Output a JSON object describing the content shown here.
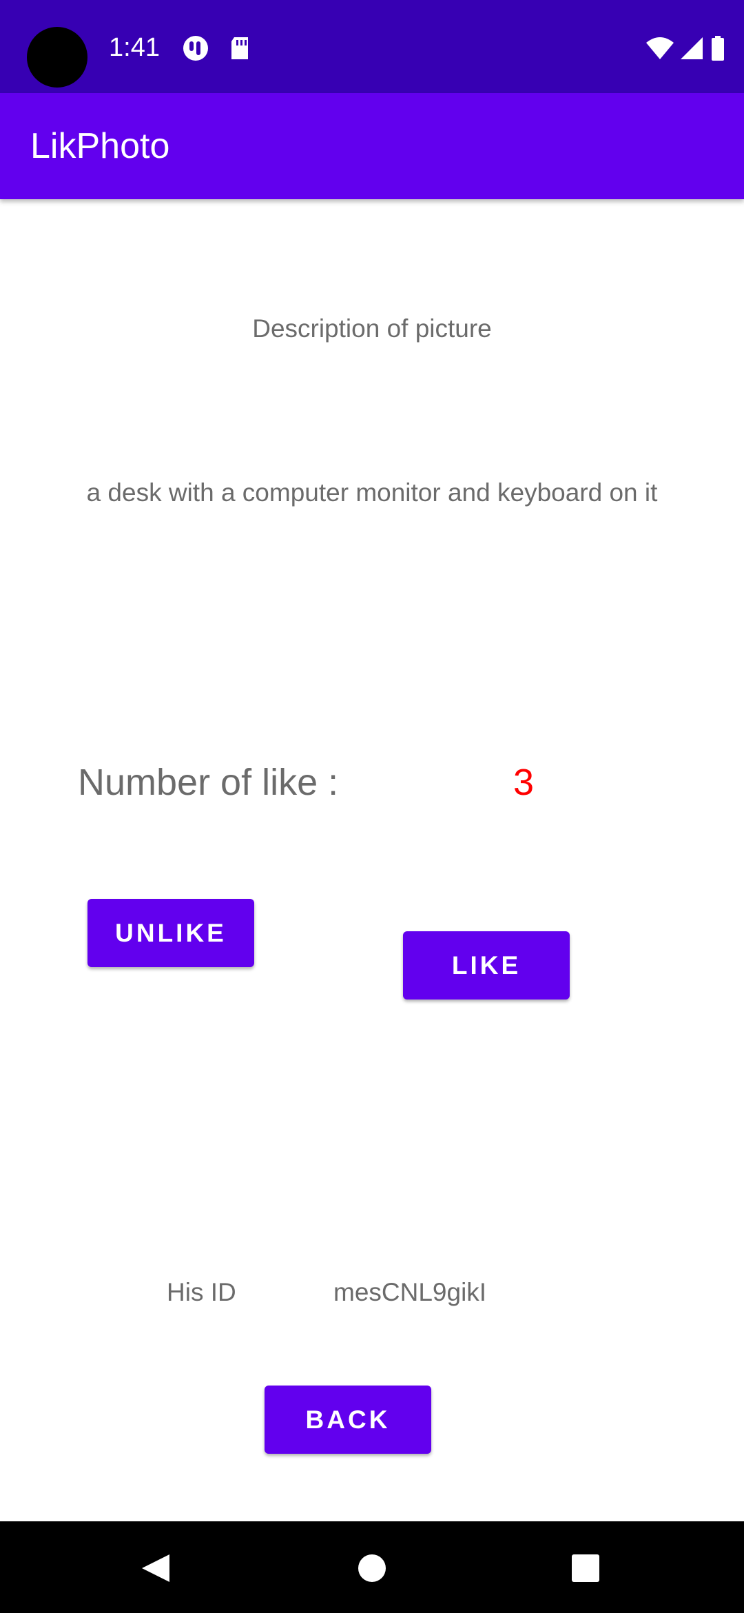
{
  "status_bar": {
    "time": "1:41",
    "icons": [
      "notification-app-icon",
      "sd-card-icon",
      "wifi-icon",
      "signal-icon",
      "battery-icon"
    ]
  },
  "app_bar": {
    "title": "LikPhoto"
  },
  "content": {
    "description_header": "Description of picture",
    "description_text": "a desk with a computer monitor and keyboard on it",
    "likes_label": "Number of like :",
    "likes_count": "3",
    "unlike_label": "UNLIKE",
    "like_label": "LIKE",
    "id_label": "His ID",
    "id_value": "mesCNL9gikI",
    "back_label": "BACK"
  },
  "nav_bar": {
    "buttons": [
      "back-triangle-icon",
      "home-circle-icon",
      "recents-square-icon"
    ]
  },
  "colors": {
    "status_bar": "#3700b3",
    "primary": "#6200ee",
    "likes_count": "#ff0000",
    "text_gray": "#6b6b6b"
  }
}
